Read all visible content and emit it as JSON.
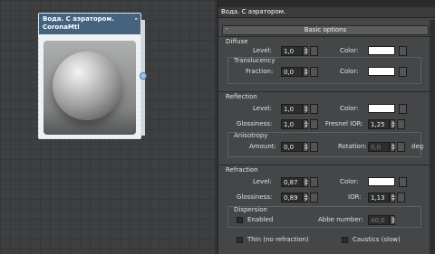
{
  "node": {
    "title_line1": "Вода. С аэратором.",
    "title_line2": "CoronaMtl",
    "dash": "-"
  },
  "panel": {
    "material_name": "Вода. С аэратором.",
    "rollout": "Basic options",
    "rollout_toggle": "-",
    "diffuse": {
      "header": "Diffuse",
      "level_label": "Level:",
      "level": "1,0",
      "color_label": "Color:",
      "color": "#ffffff",
      "translucency": {
        "header": "Translucency",
        "fraction_label": "Fraction:",
        "fraction": "0,0",
        "color_label": "Color:",
        "color": "#ffffff"
      }
    },
    "reflection": {
      "header": "Reflection",
      "level_label": "Level:",
      "level": "1,0",
      "color_label": "Color:",
      "color": "#ffffff",
      "glossiness_label": "Glossiness:",
      "glossiness": "1,0",
      "fresnel_label": "Fresnel IOR:",
      "fresnel": "1,25",
      "anisotropy": {
        "header": "Anisotropy",
        "amount_label": "Amount:",
        "amount": "0,0",
        "rotation_label": "Rotation:",
        "rotation": "0,0",
        "unit": "deg"
      }
    },
    "refraction": {
      "header": "Refraction",
      "level_label": "Level:",
      "level": "0,87",
      "color_label": "Color:",
      "color": "#ffffff",
      "glossiness_label": "Glossiness:",
      "glossiness": "0,89",
      "ior_label": "IOR:",
      "ior": "1,13",
      "dispersion": {
        "header": "Dispersion",
        "enabled_label": "Enabled",
        "abbe_label": "Abbe number:",
        "abbe": "40,0"
      },
      "thin_label": "Thin (no refraction)",
      "caustics_label": "Caustics (slow)"
    }
  }
}
